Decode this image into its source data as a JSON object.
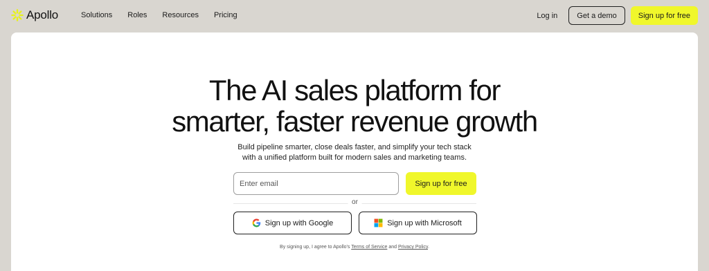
{
  "nav": {
    "logo_text": "Apollo",
    "links": [
      "Solutions",
      "Roles",
      "Resources",
      "Pricing"
    ],
    "login_label": "Log in",
    "demo_label": "Get a demo",
    "signup_label": "Sign up for free"
  },
  "hero": {
    "headline_line1": "The AI sales platform for",
    "headline_line2": "smarter, faster revenue growth",
    "subtext_line1": "Build pipeline smarter, close deals faster, and simplify your tech stack",
    "subtext_line2": "with a unified platform built for modern sales and marketing teams.",
    "email_placeholder": "Enter email",
    "signup_label": "Sign up for free",
    "divider_text": "or",
    "google_label": "Sign up with Google",
    "microsoft_label": "Sign up with Microsoft",
    "legal_prefix": "By signing up, I agree to Apollo's",
    "legal_terms": "Terms of Service",
    "legal_and": "and",
    "legal_privacy": "Privacy Policy",
    "legal_suffix": "."
  },
  "colors": {
    "background": "#d9d6d0",
    "accent": "#f0f72b",
    "card": "#ffffff"
  },
  "icons": {
    "logo": "apollo-sunburst-icon",
    "google": "google-icon",
    "microsoft": "microsoft-icon"
  }
}
